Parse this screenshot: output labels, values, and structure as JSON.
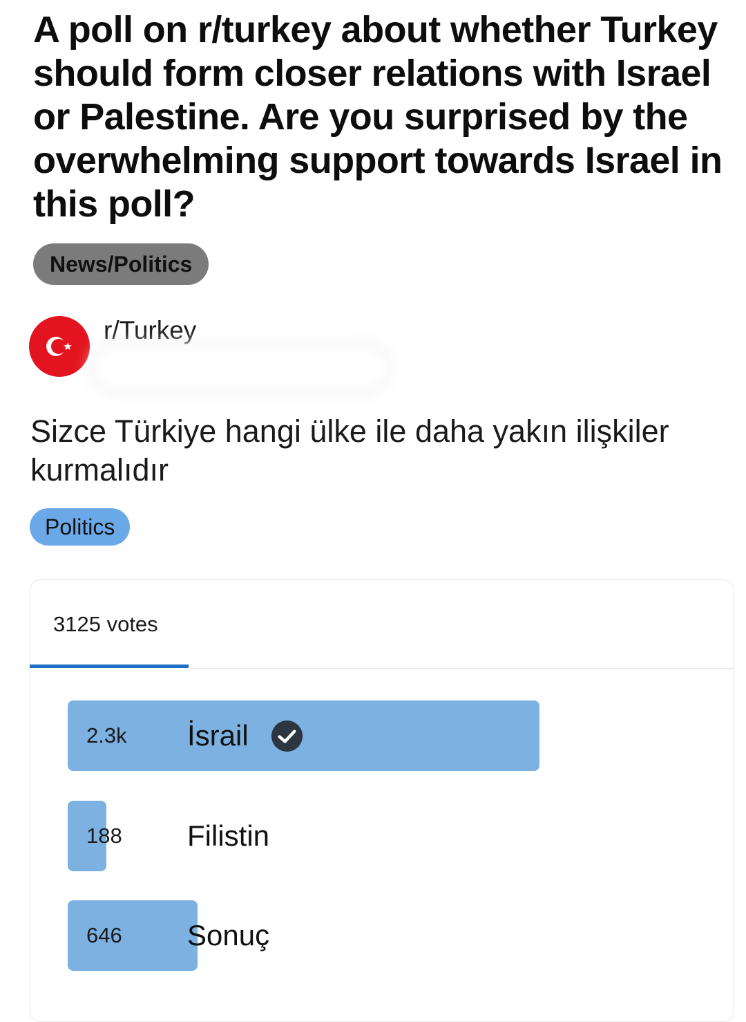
{
  "post": {
    "title": "A poll on r/turkey about whether Turkey should form closer relations with Israel or Palestine. Are you surprised by the overwhelming support towards Israel in this poll?",
    "flair": "News/Politics"
  },
  "subreddit": {
    "name": "r/Turkey",
    "avatar_icon": "turkish-flag-icon",
    "avatar_color": "#e3141f"
  },
  "poll": {
    "question": "Sizce Türkiye hangi ülke ile daha yakın ilişkiler kurmalıdır",
    "flair": "Politics",
    "flair_color": "#6aa8e8",
    "bar_color": "#7cb1e2",
    "tab_label": "3125 votes",
    "options": [
      {
        "count": "2.3k",
        "label": "İsrail",
        "selected": true,
        "fraction": 1.0
      },
      {
        "count": "188",
        "label": "Filistin",
        "selected": false,
        "fraction": 0.082
      },
      {
        "count": "646",
        "label": "Sonuç",
        "selected": false,
        "fraction": 0.275
      }
    ],
    "selected_icon": "check-circle-icon"
  }
}
